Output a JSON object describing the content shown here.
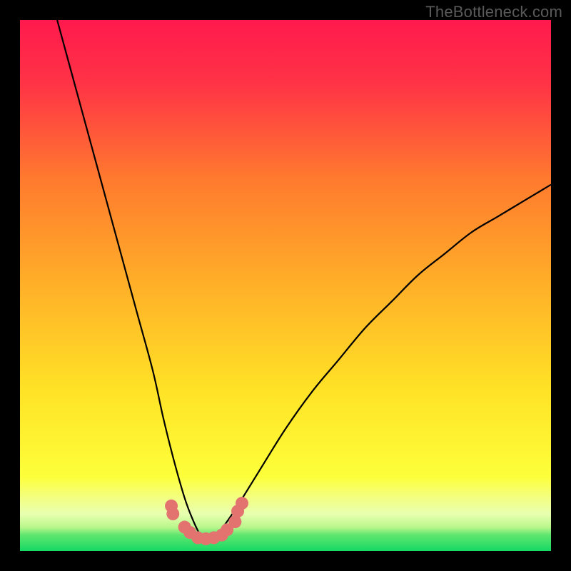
{
  "watermark": "TheBottleneck.com",
  "colors": {
    "frame": "#000000",
    "gradient_top": "#ff1a4d",
    "gradient_mid1": "#ff8a26",
    "gradient_mid2": "#ffe326",
    "gradient_band": "#f7ff8a",
    "gradient_green": "#1ae66b",
    "curve": "#000000",
    "markers": "#e2736f"
  },
  "chart_data": {
    "type": "line",
    "title": "",
    "xlabel": "",
    "ylabel": "",
    "xlim": [
      0,
      100
    ],
    "ylim": [
      0,
      100
    ],
    "series": [
      {
        "name": "bottleneck-curve",
        "x": [
          7,
          10,
          13,
          16,
          19,
          22,
          25,
          27,
          29,
          31,
          32.5,
          34,
          35.5,
          37,
          40,
          45,
          50,
          55,
          60,
          65,
          70,
          75,
          80,
          85,
          90,
          95,
          100
        ],
        "y": [
          100,
          89,
          78,
          67,
          56,
          45,
          34,
          25,
          17,
          10,
          6,
          3,
          2,
          3,
          7,
          15,
          23,
          30,
          36,
          42,
          47,
          52,
          56,
          60,
          63,
          66,
          69
        ]
      }
    ],
    "markers": {
      "name": "highlighted-points",
      "x": [
        28.5,
        28.8,
        31,
        32,
        33.5,
        35,
        36.5,
        38,
        39,
        40.5,
        41,
        41.8
      ],
      "y": [
        8.5,
        7,
        4.5,
        3.5,
        2.5,
        2.3,
        2.5,
        3,
        4,
        5.5,
        7.5,
        9
      ]
    }
  }
}
